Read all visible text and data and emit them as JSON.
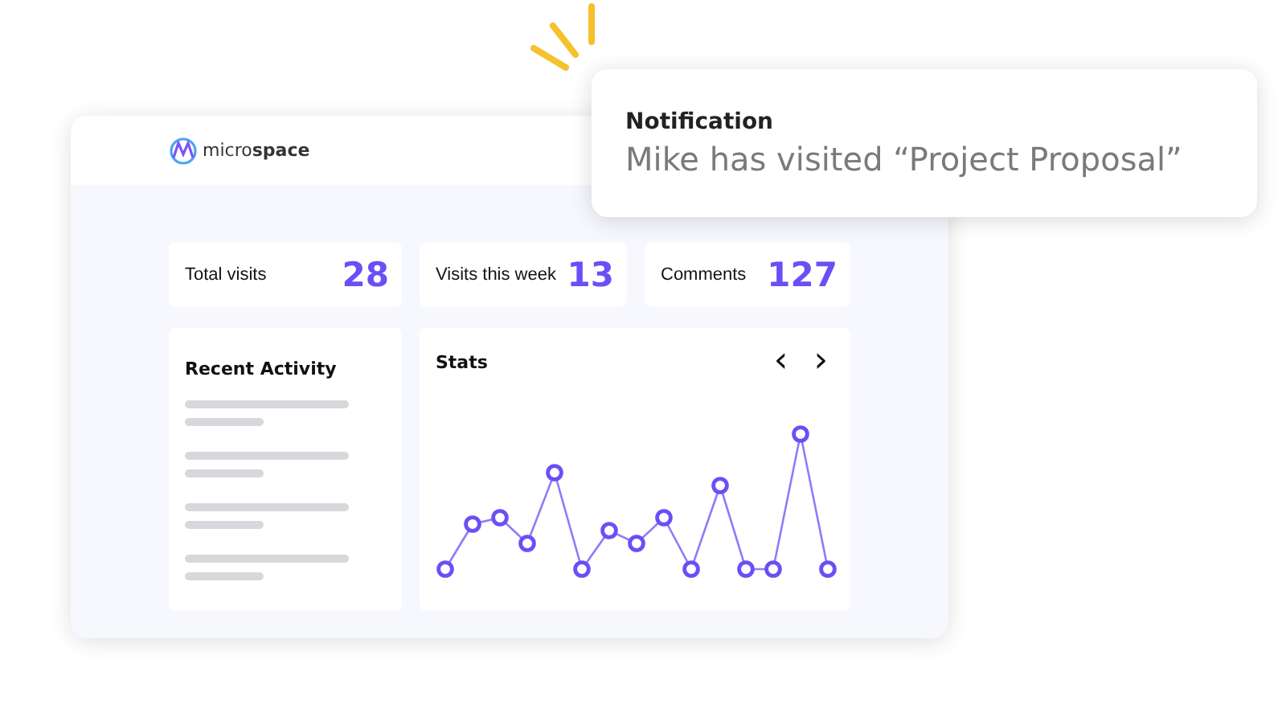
{
  "app": {
    "logo": "micro**space**"
  },
  "stats": [
    {
      "label": "Total visits",
      "value": "28"
    },
    {
      "label": "Visits this week",
      "value": "13"
    },
    {
      "label": "Comments",
      "value": "127"
    }
  ],
  "recent_activity": {
    "title": "Recent Activity"
  },
  "chart": {
    "title": "Stats",
    "prev": "‹",
    "next": "›"
  },
  "notification": {
    "title": "Notification",
    "message": "Mike has visited “Project Proposal”"
  }
}
